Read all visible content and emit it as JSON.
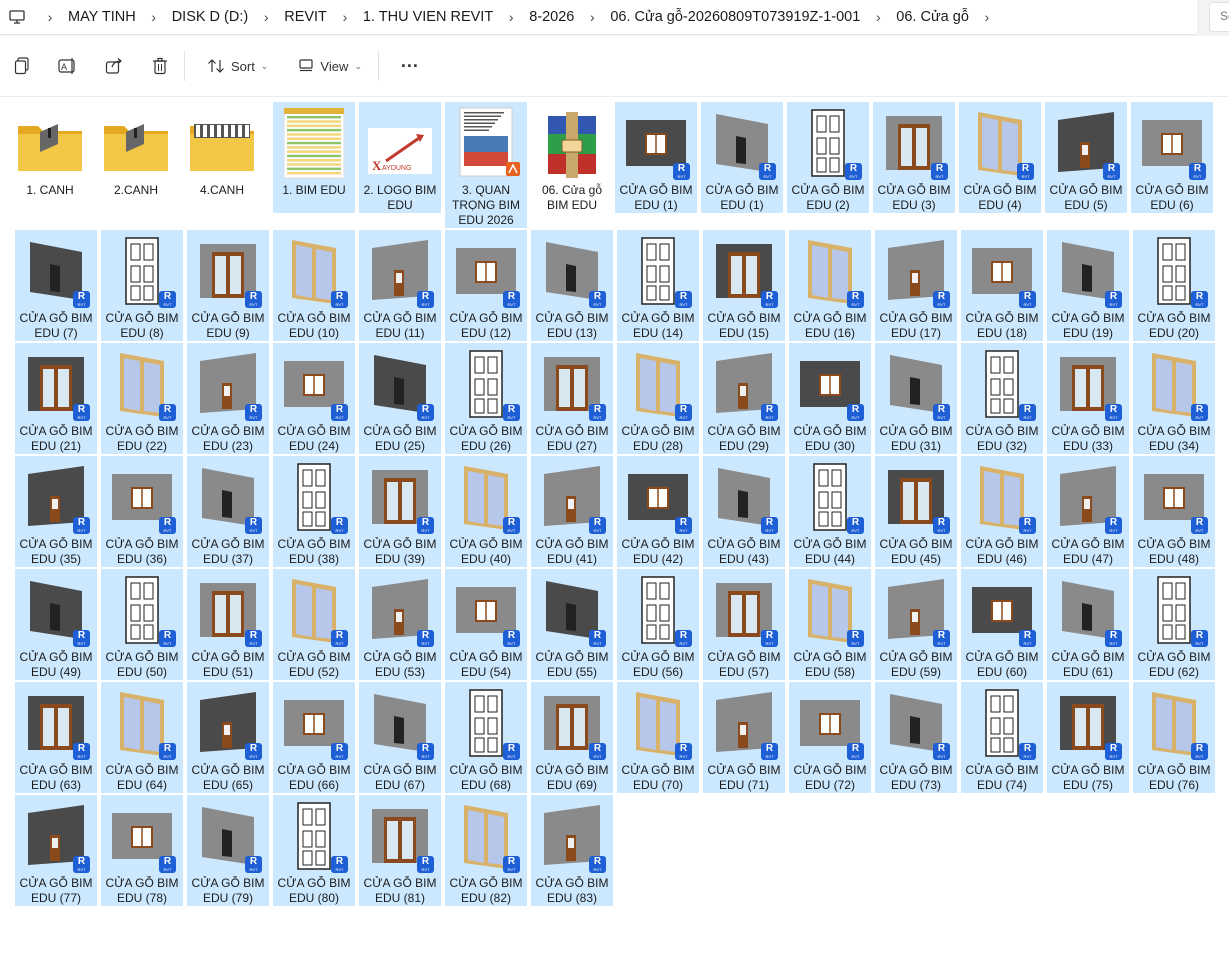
{
  "breadcrumb": {
    "items": [
      "MAY TINH",
      "DISK D (D:)",
      "REVIT",
      "1. THU VIEN REVIT",
      "8-2026",
      "06. Cửa gỗ-20260809T073919Z-1-001",
      "06. Cửa gỗ"
    ]
  },
  "search": {
    "placeholder": "Se"
  },
  "toolbar": {
    "sort_label": "Sort",
    "view_label": "View",
    "more_label": "···"
  },
  "folders": [
    {
      "label": "1. CANH",
      "kind": "folder-canh"
    },
    {
      "label": "2.CANH",
      "kind": "folder-canh"
    },
    {
      "label": "4.CANH",
      "kind": "folder-doors"
    }
  ],
  "files": [
    {
      "label": "1. BIM EDU",
      "kind": "sheet",
      "selected": true
    },
    {
      "label": "2. LOGO BIM EDU",
      "kind": "logo",
      "selected": true
    },
    {
      "label": "3. QUAN TRỌNG BIM EDU 2026",
      "kind": "doc",
      "selected": true
    },
    {
      "label": "06. Cửa gỗ BIM EDU",
      "kind": "rar",
      "selected": false
    }
  ],
  "rvt_badge": {
    "letter": "R",
    "ext": "RVT"
  },
  "family_prefix": "CỬA GỖ BIM EDU",
  "families": [
    "CỬA GỖ BIM EDU (1)",
    "CỬA GỖ BIM EDU (1)",
    "CỬA GỖ BIM EDU (2)",
    "CỬA GỖ BIM EDU (3)",
    "CỬA GỖ BIM EDU (4)",
    "CỬA GỖ BIM EDU (5)",
    "CỬA GỖ BIM EDU (6)",
    "CỬA GỖ BIM EDU (7)",
    "CỬA GỖ BIM EDU (8)",
    "CỬA GỖ BIM EDU (9)",
    "CỬA GỖ BIM EDU (10)",
    "CỬA GỖ BIM EDU (11)",
    "CỬA GỖ BIM EDU (12)",
    "CỬA GỖ BIM EDU (13)",
    "CỬA GỖ BIM EDU (14)",
    "CỬA GỖ BIM EDU (15)",
    "CỬA GỖ BIM EDU (16)",
    "CỬA GỖ BIM EDU (17)",
    "CỬA GỖ BIM EDU (18)",
    "CỬA GỖ BIM EDU (19)",
    "CỬA GỖ BIM EDU (20)",
    "CỬA GỖ BIM EDU (21)",
    "CỬA GỖ BIM EDU (22)",
    "CỬA GỖ BIM EDU (23)",
    "CỬA GỖ BIM EDU (24)",
    "CỬA GỖ BIM EDU (25)",
    "CỬA GỖ BIM EDU (26)",
    "CỬA GỖ BIM EDU (27)",
    "CỬA GỖ BIM EDU (28)",
    "CỬA GỖ BIM EDU (29)",
    "CỬA GỖ BIM EDU (30)",
    "CỬA GỖ BIM EDU (31)",
    "CỬA GỖ BIM EDU (32)",
    "CỬA GỖ BIM EDU (33)",
    "CỬA GỖ BIM EDU (34)",
    "CỬA GỖ BIM EDU (35)",
    "CỬA GỖ BIM EDU (36)",
    "CỬA GỖ BIM EDU (37)",
    "CỬA GỖ BIM EDU (38)",
    "CỬA GỖ BIM EDU (39)",
    "CỬA GỖ BIM EDU (40)",
    "CỬA GỖ BIM EDU (41)",
    "CỬA GỖ BIM EDU (42)",
    "CỬA GỖ BIM EDU (43)",
    "CỬA GỖ BIM EDU (44)",
    "CỬA GỖ BIM EDU (45)",
    "CỬA GỖ BIM EDU (46)",
    "CỬA GỖ BIM EDU (47)",
    "CỬA GỖ BIM EDU (48)",
    "CỬA GỖ BIM EDU (49)",
    "CỬA GỖ BIM EDU (50)",
    "CỬA GỖ BIM EDU (51)",
    "CỬA GỖ BIM EDU (52)",
    "CỬA GỖ BIM EDU (53)",
    "CỬA GỖ BIM EDU (54)",
    "CỬA GỖ BIM EDU (55)",
    "CỬA GỖ BIM EDU (56)",
    "CỬA GỖ BIM EDU (57)",
    "CỬA GỖ BIM EDU (58)",
    "CỬA GỖ BIM EDU (59)",
    "CỬA GỖ BIM EDU (60)",
    "CỬA GỖ BIM EDU (61)",
    "CỬA GỖ BIM EDU (62)",
    "CỬA GỖ BIM EDU (63)",
    "CỬA GỖ BIM EDU (64)",
    "CỬA GỖ BIM EDU (65)",
    "CỬA GỖ BIM EDU (66)",
    "CỬA GỖ BIM EDU (67)",
    "CỬA GỖ BIM EDU (68)",
    "CỬA GỖ BIM EDU (69)",
    "CỬA GỖ BIM EDU (70)",
    "CỬA GỖ BIM EDU (71)",
    "CỬA GỖ BIM EDU (72)",
    "CỬA GỖ BIM EDU (73)",
    "CỬA GỖ BIM EDU (74)",
    "CỬA GỖ BIM EDU (75)",
    "CỬA GỖ BIM EDU (76)",
    "CỬA GỖ BIM EDU (77)",
    "CỬA GỖ BIM EDU (78)",
    "CỬA GỖ BIM EDU (79)",
    "CỬA GỖ BIM EDU (80)",
    "CỬA GỖ BIM EDU (81)",
    "CỬA GỖ BIM EDU (82)",
    "CỬA GỖ BIM EDU (83)"
  ],
  "colors": {
    "selection": "#cce8ff",
    "folder": "#f3c746",
    "wall_gray": "#8a8a8a",
    "wall_dark": "#4a4a4a",
    "wood": "#8b4a1e",
    "rvt_badge": "#1f5fd6"
  }
}
